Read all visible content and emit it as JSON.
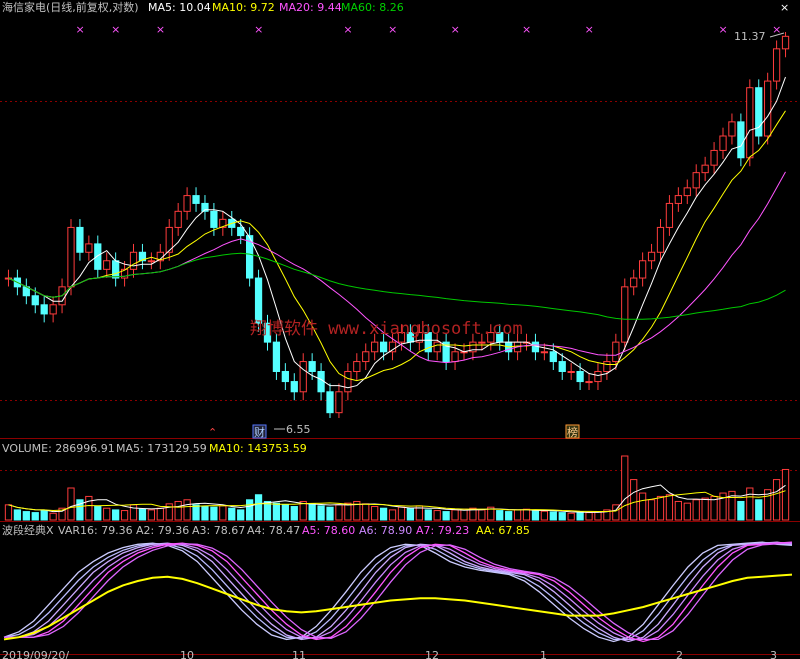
{
  "panel1": {
    "title": "海信家电(日线,前复权,对数)",
    "ma5_label": "MA5: 10.04",
    "ma10_label": "MA10: 9.72",
    "ma20_label": "MA20: 9.44",
    "ma60_label": "MA60: 8.26",
    "high_label": "11.37",
    "low_label": "6.55",
    "badge1": "财",
    "badge2": "榜",
    "watermark": "翔博软件 www.xiangbosoft.com"
  },
  "panel2": {
    "volume_label": "VOLUME: 286996.91",
    "ma5_label": "MA5: 173129.59",
    "ma10_label": "MA10: 143753.59"
  },
  "panel3": {
    "name": "波段经典X",
    "var16": "VAR16: 79.36",
    "a2": "A2: 79.36",
    "a3": "A3: 78.67",
    "a4": "A4: 78.47",
    "a5": "A5: 78.60",
    "a6": "A6: 78.90",
    "a7": "A7: 79.23",
    "aa": "AA: 67.85"
  },
  "x_axis_labels": [
    "2019/09/20/",
    "10",
    "11",
    "12",
    "1",
    "2",
    "3"
  ],
  "colors": {
    "up": "#ff3c3c",
    "down": "#54ffff",
    "ma5": "#ffffff",
    "ma10": "#ffff00",
    "ma20": "#ff55ff",
    "ma60": "#00c800",
    "grid": "#8b0000",
    "aa": "#ffff00"
  },
  "chart_data": [
    {
      "type": "candlestick",
      "title": "海信家电(日线,前复权,对数)",
      "close": [
        8.0,
        7.9,
        7.8,
        7.7,
        7.6,
        7.7,
        7.9,
        8.6,
        8.3,
        8.4,
        8.1,
        8.2,
        8.0,
        8.1,
        8.3,
        8.2,
        8.2,
        8.3,
        8.6,
        8.8,
        9.0,
        8.9,
        8.8,
        8.6,
        8.7,
        8.6,
        8.5,
        8.0,
        7.5,
        7.3,
        7.0,
        6.9,
        6.8,
        7.1,
        7.0,
        6.8,
        6.6,
        6.8,
        7.0,
        7.1,
        7.2,
        7.3,
        7.2,
        7.3,
        7.4,
        7.3,
        7.4,
        7.2,
        7.3,
        7.1,
        7.2,
        7.2,
        7.3,
        7.3,
        7.4,
        7.3,
        7.2,
        7.3,
        7.3,
        7.2,
        7.2,
        7.1,
        7.0,
        7.0,
        6.9,
        6.9,
        7.0,
        7.1,
        7.3,
        7.9,
        8.0,
        8.2,
        8.3,
        8.6,
        8.9,
        9.0,
        9.1,
        9.3,
        9.4,
        9.6,
        9.8,
        10.0,
        9.5,
        10.5,
        9.8,
        10.6,
        11.1,
        11.3
      ],
      "ma5_last": 10.04,
      "ma10_last": 9.72,
      "ma20_last": 9.44,
      "ma60_last": 8.26,
      "high": 11.37,
      "low": 6.55
    },
    {
      "type": "bar",
      "title": "VOLUME",
      "last": 286996.91,
      "ma5": 173129.59,
      "ma10": 143753.59,
      "values": [
        45,
        30,
        25,
        22,
        28,
        20,
        35,
        95,
        60,
        70,
        40,
        35,
        30,
        28,
        45,
        32,
        30,
        35,
        48,
        55,
        60,
        45,
        40,
        38,
        42,
        35,
        30,
        60,
        75,
        55,
        50,
        45,
        40,
        55,
        48,
        42,
        38,
        45,
        50,
        55,
        48,
        40,
        35,
        30,
        38,
        35,
        42,
        30,
        28,
        25,
        30,
        32,
        35,
        30,
        38,
        28,
        25,
        30,
        32,
        28,
        26,
        24,
        22,
        20,
        25,
        22,
        24,
        30,
        45,
        190,
        120,
        80,
        60,
        70,
        75,
        55,
        50,
        60,
        65,
        70,
        80,
        85,
        55,
        95,
        60,
        90,
        120,
        150
      ]
    },
    {
      "type": "line",
      "title": "波段经典X",
      "var16": 79.36,
      "A2": 79.36,
      "A3": 78.67,
      "A4": 78.47,
      "A5": 78.6,
      "A6": 78.9,
      "A7": 79.23,
      "AA": 67.85,
      "wave": [
        10,
        15,
        25,
        40,
        55,
        70,
        80,
        88,
        93,
        96,
        97,
        95,
        90,
        80,
        65,
        50,
        35,
        22,
        12,
        8,
        10,
        20,
        35,
        52,
        70,
        84,
        93,
        96,
        95,
        88,
        80,
        75,
        72,
        70,
        68,
        62,
        52,
        40,
        28,
        18,
        10,
        6,
        10,
        22,
        40,
        58,
        75,
        88,
        95,
        96,
        97,
        98,
        96,
        95
      ],
      "aa": [
        8,
        10,
        14,
        20,
        28,
        36,
        44,
        52,
        58,
        62,
        65,
        66,
        64,
        60,
        55,
        50,
        45,
        40,
        36,
        34,
        33,
        34,
        36,
        38,
        40,
        42,
        44,
        45,
        46,
        46,
        45,
        44,
        42,
        40,
        38,
        36,
        34,
        32,
        30,
        30,
        30,
        32,
        35,
        38,
        42,
        46,
        50,
        54,
        58,
        62,
        65,
        66,
        67,
        68
      ]
    }
  ]
}
